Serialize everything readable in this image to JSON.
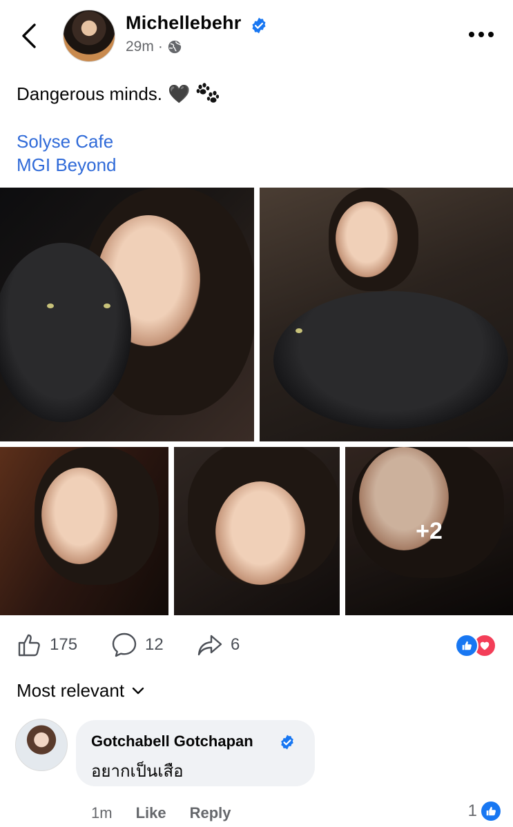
{
  "header": {
    "author": "Michellebehr",
    "time": "29m",
    "separator": "·",
    "privacy_icon": "globe-icon",
    "back_icon": "chevron-left-icon",
    "more_icon": "more-horizontal-icon"
  },
  "post": {
    "caption": "Dangerous minds.",
    "emoji_heart": "🖤",
    "emoji_paws": "paws-icon",
    "tags": [
      "Solyse Cafe",
      "MGI Beyond"
    ],
    "more_photos_label": "+2"
  },
  "stats": {
    "likes": "175",
    "comments": "12",
    "shares": "6",
    "reactions": [
      "like",
      "love"
    ]
  },
  "sort": {
    "label": "Most relevant"
  },
  "comment": {
    "author": "Gotchabell Gotchapan",
    "text": "อยากเป็นเสือ",
    "time": "1m",
    "like_label": "Like",
    "reply_label": "Reply",
    "like_count": "1"
  },
  "colors": {
    "link": "#2f6ad8",
    "verified": "#1877f2",
    "like": "#1877f2",
    "love": "#f33e58",
    "muted": "#65676b",
    "bubble": "#f0f2f5"
  }
}
